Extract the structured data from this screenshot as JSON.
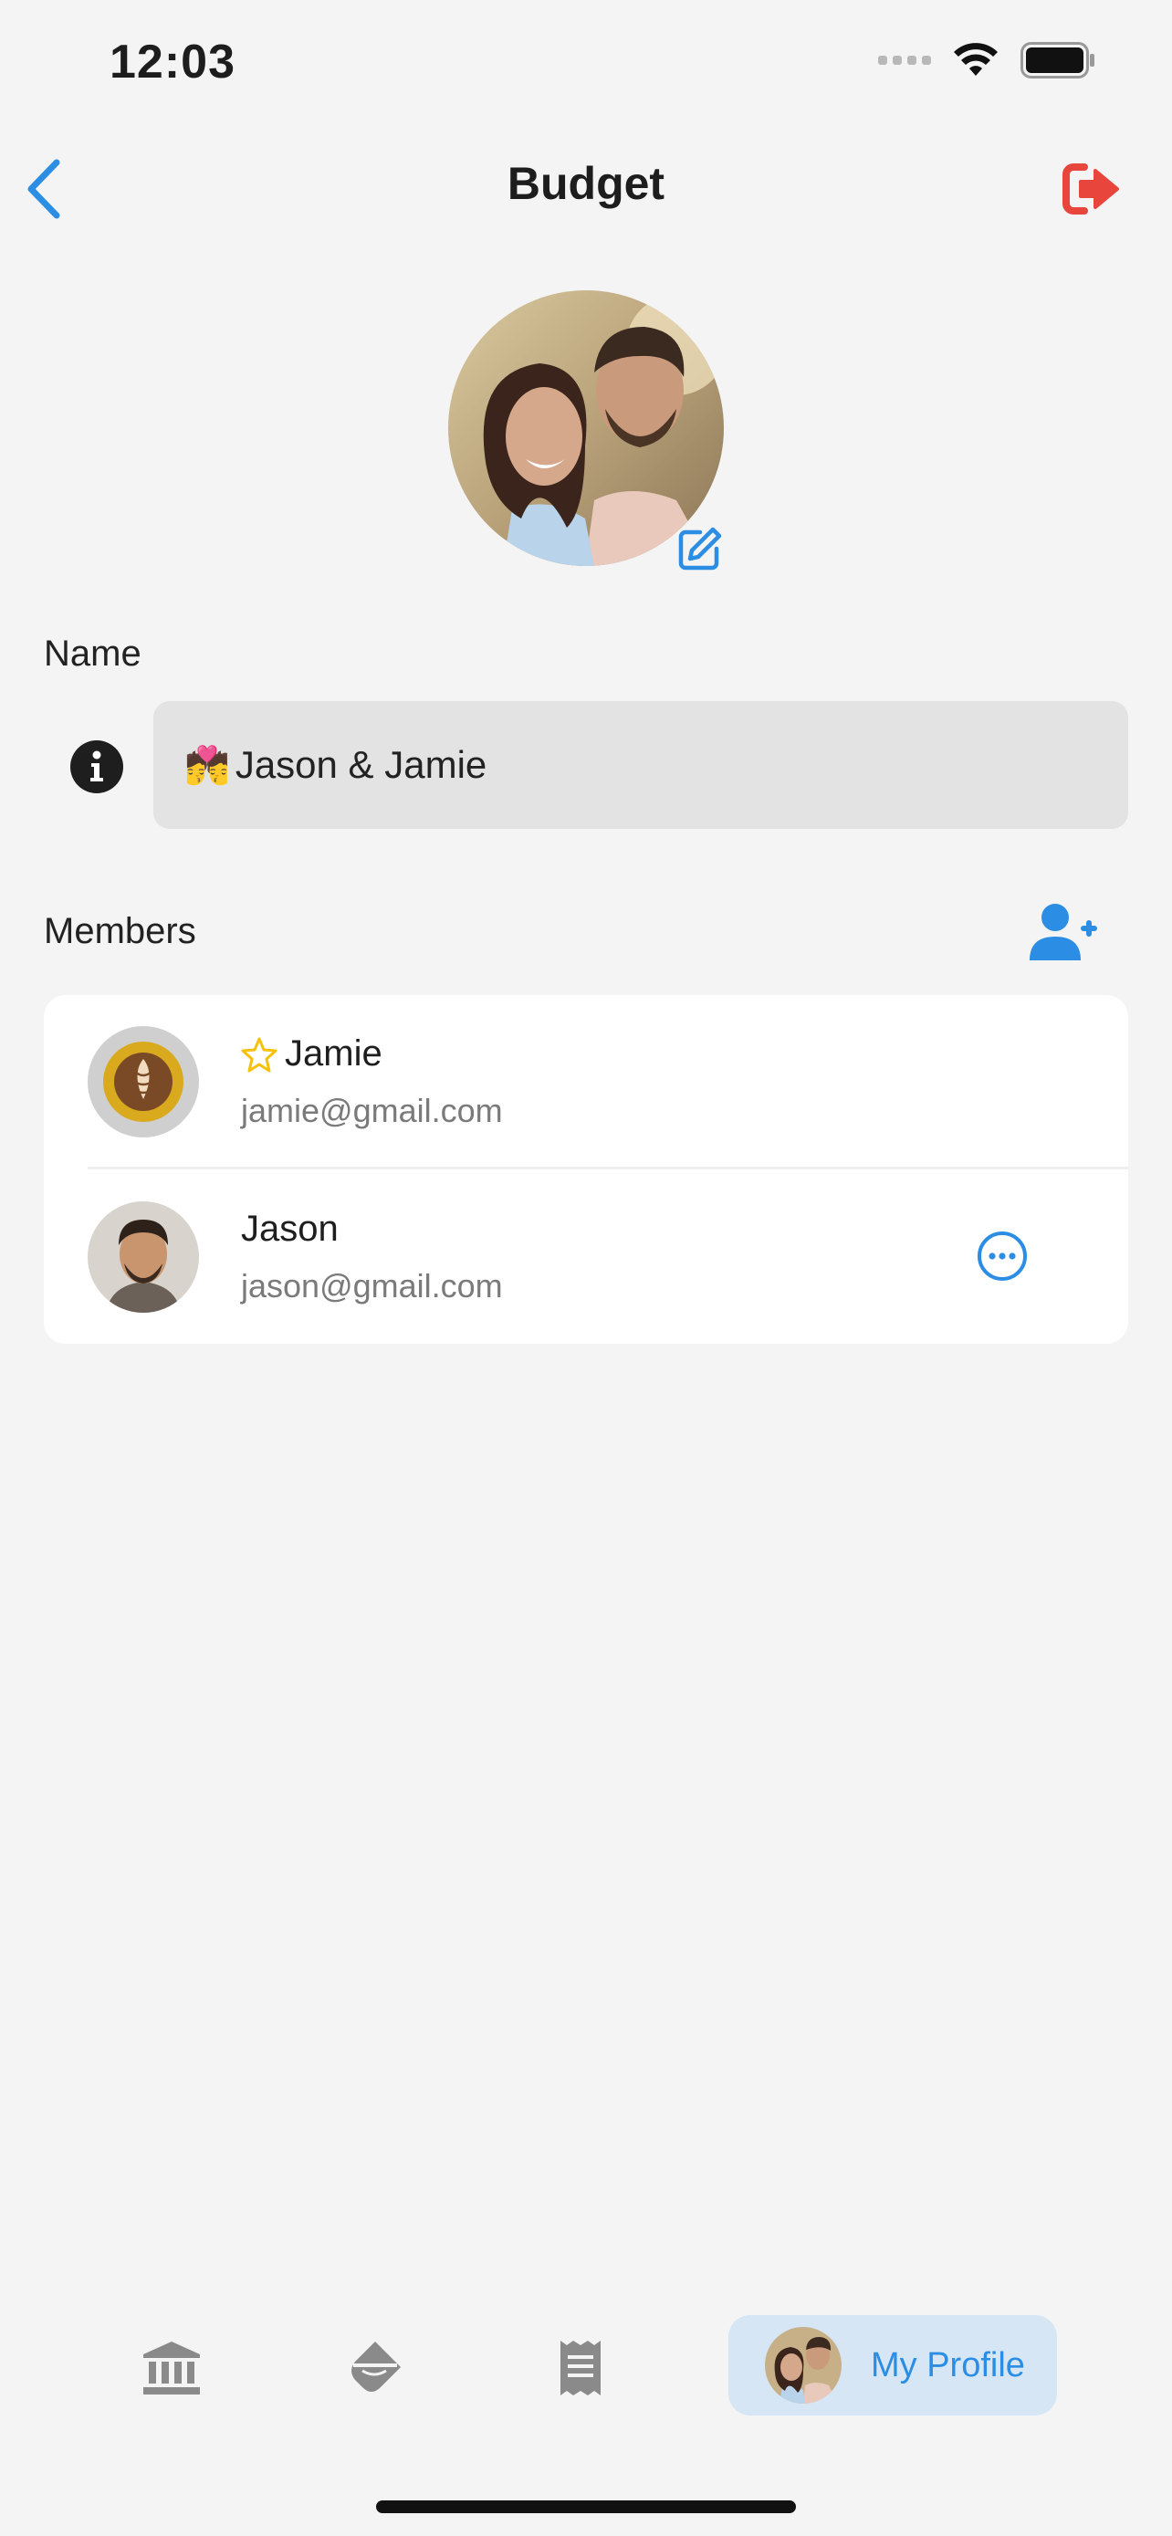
{
  "status_bar": {
    "time": "12:03"
  },
  "header": {
    "title": "Budget"
  },
  "name_section": {
    "label": "Name",
    "value_emoji": "💏",
    "value": "Jason & Jamie"
  },
  "members_section": {
    "label": "Members",
    "members": [
      {
        "name": "Jamie",
        "email": "jamie@gmail.com",
        "owner": true
      },
      {
        "name": "Jason",
        "email": "jason@gmail.com",
        "owner": false
      }
    ]
  },
  "bottom_nav": {
    "items": [
      {
        "icon": "bank-icon"
      },
      {
        "icon": "paint-bucket-icon"
      },
      {
        "icon": "receipt-icon"
      }
    ],
    "active": {
      "label": "My Profile",
      "icon": "profile-avatar"
    }
  },
  "colors": {
    "accent": "#2b8de3",
    "danger": "#e8453c",
    "background": "#f4f4f4",
    "field": "#e3e3e3",
    "star": "#f4c20d"
  }
}
